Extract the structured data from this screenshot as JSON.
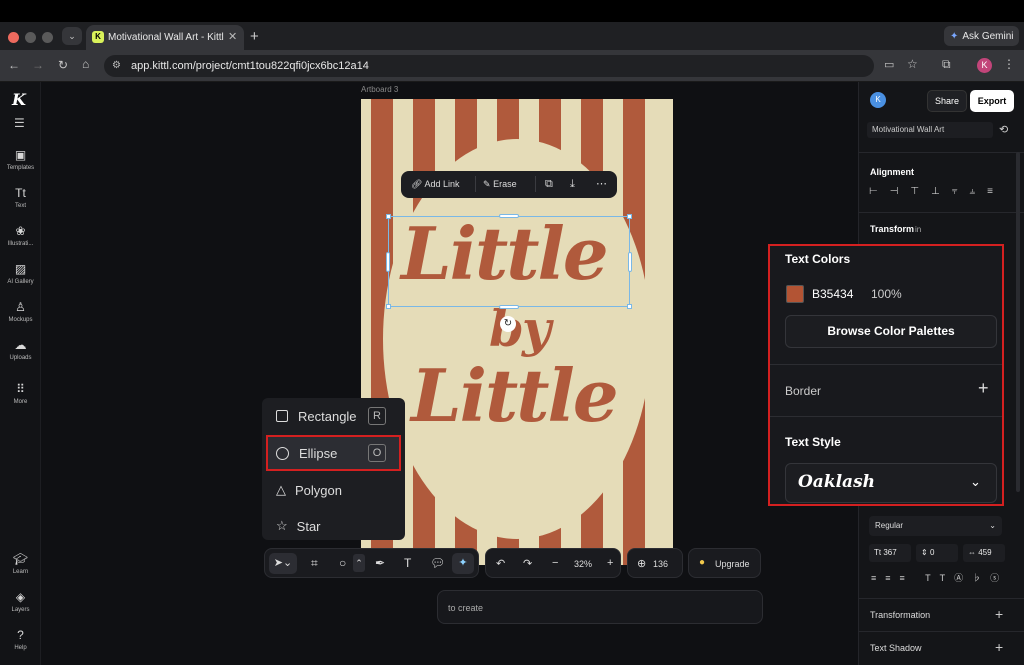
{
  "browser": {
    "tab_title": "Motivational Wall Art - Kittl",
    "url": "app.kittl.com/project/cmt1tou822qfi0jcx6bc12a14",
    "gemini_label": "Ask Gemini",
    "profile_initial": "K"
  },
  "sidebar": {
    "logo": "K",
    "items": [
      {
        "label": "Templates",
        "icon": "template-icon"
      },
      {
        "label": "Text",
        "icon": "text-icon"
      },
      {
        "label": "Illustrati...",
        "icon": "illustration-icon"
      },
      {
        "label": "AI Gallery",
        "icon": "image-icon"
      },
      {
        "label": "Mockups",
        "icon": "shirt-icon"
      },
      {
        "label": "Uploads",
        "icon": "upload-icon"
      },
      {
        "label": "More",
        "icon": "grid-icon"
      }
    ],
    "bottom_items": [
      {
        "label": "Learn",
        "icon": "graduation-icon"
      },
      {
        "label": "Layers",
        "icon": "layers-icon"
      },
      {
        "label": "Help",
        "icon": "help-icon"
      }
    ]
  },
  "canvas": {
    "artboard_label": "Artboard 3",
    "text_line1": "Little",
    "text_line2": "by",
    "text_line3": "Little",
    "context_toolbar": {
      "add_link": "Add Link",
      "erase": "Erase"
    }
  },
  "shape_menu": {
    "items": [
      {
        "label": "Rectangle",
        "shortcut": "R"
      },
      {
        "label": "Ellipse",
        "shortcut": "O"
      },
      {
        "label": "Polygon",
        "shortcut": ""
      },
      {
        "label": "Star",
        "shortcut": ""
      }
    ]
  },
  "prompt": {
    "placeholder": "to create"
  },
  "toolbar": {
    "zoom": "32%",
    "count": "136",
    "upgrade_label": "Upgrade"
  },
  "right_panel": {
    "avatar_initial": "K",
    "share_label": "Share",
    "export_label": "Export",
    "project_name": "Motivational Wall Art",
    "alignment_title": "Alignment",
    "transform_title": "Transform",
    "transform_unit": "in",
    "font_weight": "Regular",
    "font_size": "367",
    "line_height": "0",
    "letter_spacing": "459",
    "transformation_label": "Transformation",
    "text_shadow_label": "Text Shadow"
  },
  "popup": {
    "text_colors_title": "Text Colors",
    "color_hex": "B35434",
    "color_opacity": "100%",
    "color_swatch": "#b35434",
    "browse_label": "Browse Color Palettes",
    "border_label": "Border",
    "text_style_title": "Text Style",
    "font_name": "Oaklash"
  },
  "colors": {
    "accent": "#b05a3c",
    "highlight": "#d42020",
    "cream": "#e5dcb8"
  }
}
